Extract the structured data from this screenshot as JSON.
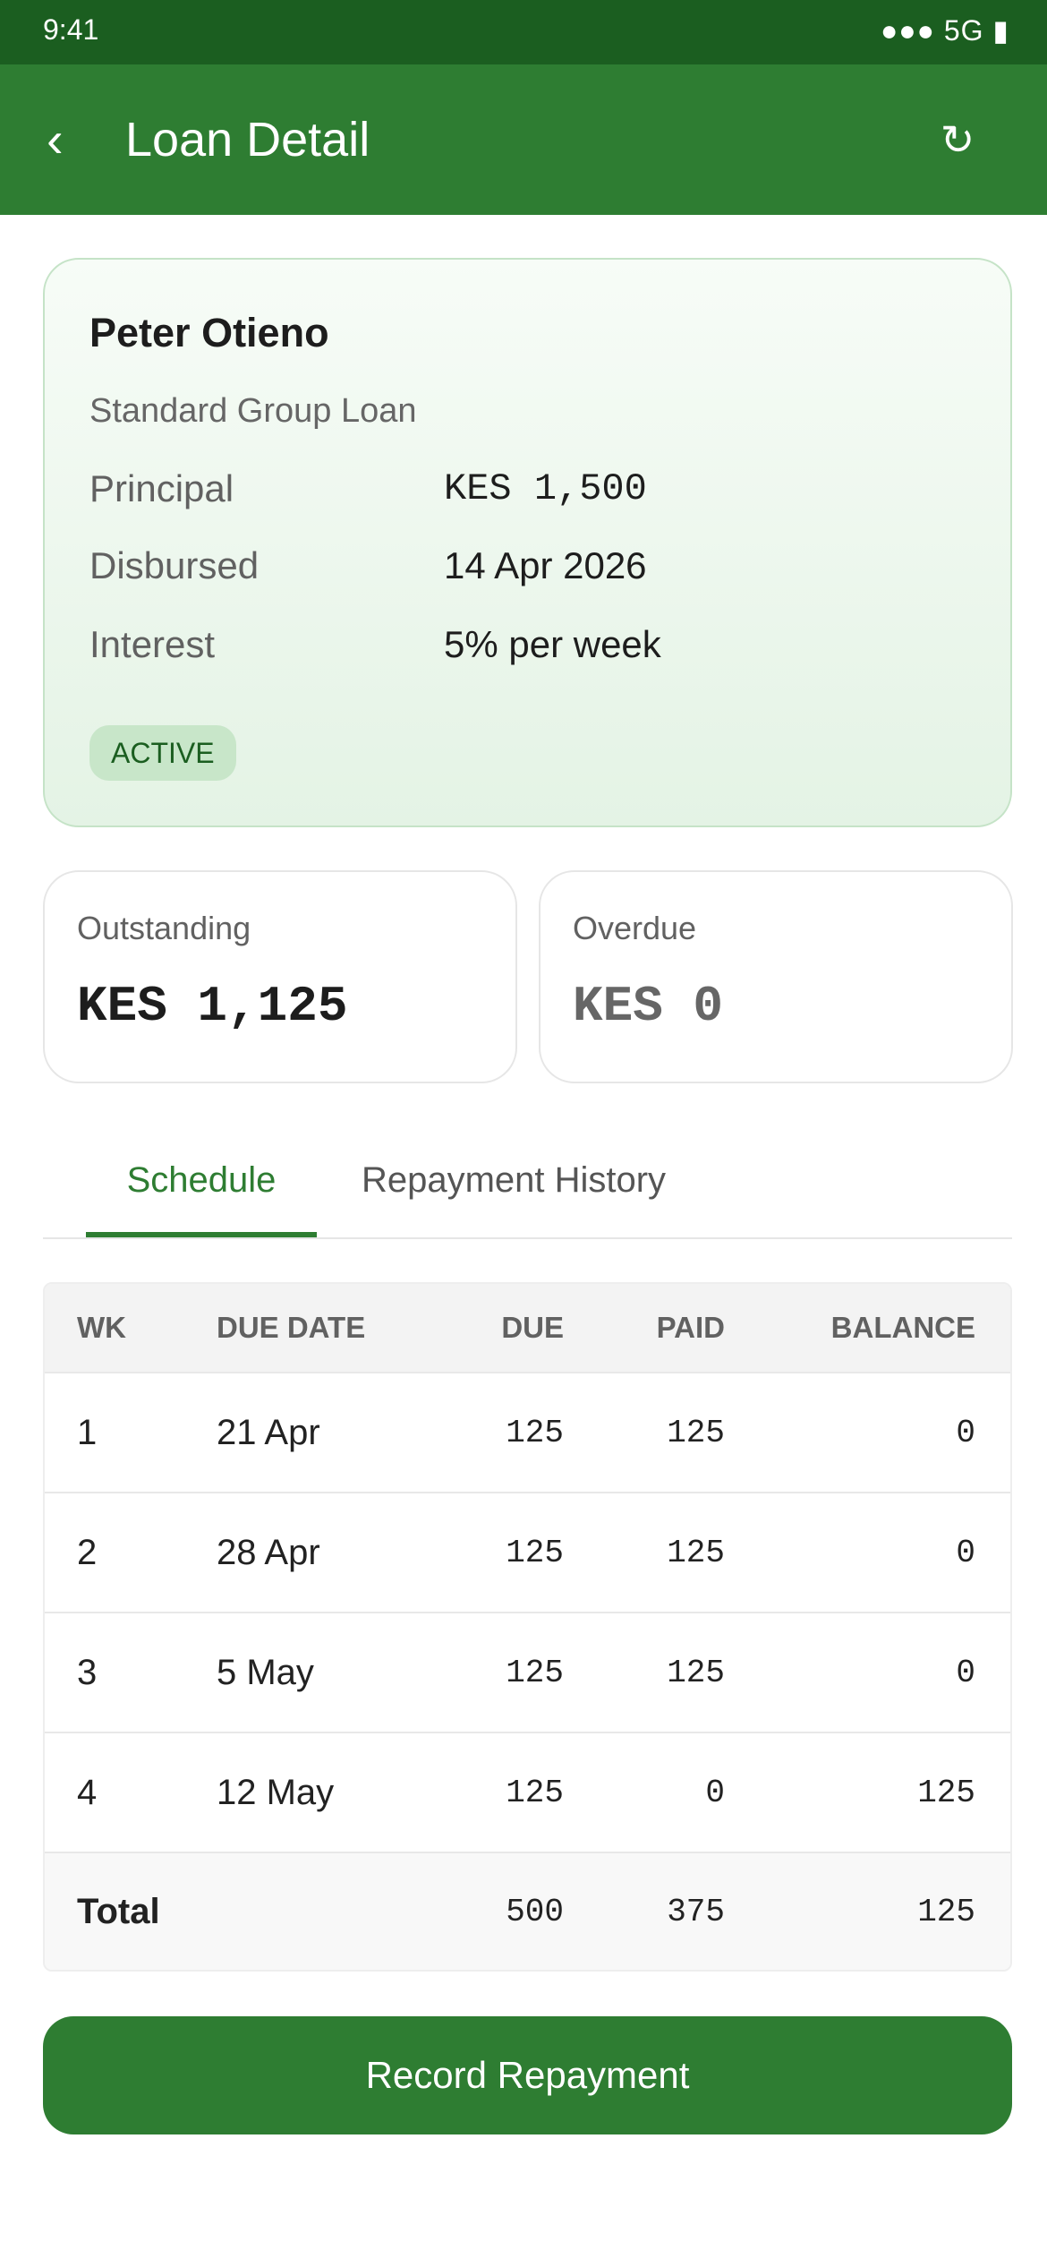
{
  "status_bar": {
    "time": "9:41",
    "indicators": "●●● 5G ▮"
  },
  "header": {
    "title": "Loan Detail",
    "back_icon": "‹",
    "refresh_icon": "↻"
  },
  "loan": {
    "borrower": "Peter Otieno",
    "product": "Standard Group Loan",
    "details": [
      {
        "label": "Principal",
        "value": "KES 1,500"
      },
      {
        "label": "Disbursed",
        "value": "14 Apr 2026"
      },
      {
        "label": "Interest",
        "value": "5% per week"
      }
    ],
    "status": "ACTIVE"
  },
  "summary": {
    "outstanding": {
      "label": "Outstanding",
      "value": "KES 1,125"
    },
    "overdue": {
      "label": "Overdue",
      "value": "KES 0"
    }
  },
  "tabs": [
    {
      "label": "Schedule",
      "active": true
    },
    {
      "label": "Repayment History",
      "active": false
    }
  ],
  "schedule": {
    "columns": [
      "WK",
      "DUE DATE",
      "DUE",
      "PAID",
      "BALANCE"
    ],
    "rows": [
      {
        "wk": "1",
        "date": "21 Apr",
        "due": "125",
        "paid": "125",
        "balance": "0"
      },
      {
        "wk": "2",
        "date": "28 Apr",
        "due": "125",
        "paid": "125",
        "balance": "0"
      },
      {
        "wk": "3",
        "date": "5 May",
        "due": "125",
        "paid": "125",
        "balance": "0"
      },
      {
        "wk": "4",
        "date": "12 May",
        "due": "125",
        "paid": "0",
        "balance": "125"
      }
    ],
    "total": {
      "label": "Total",
      "due": "500",
      "paid": "375",
      "balance": "125"
    }
  },
  "actions": {
    "record_label": "Record Repayment"
  },
  "colors": {
    "primary": "#2e7d32",
    "primary_dark": "#1b5e20",
    "status_bg": "#c8e6c9"
  },
  "icons": {
    "back": "chevron-left-icon",
    "refresh": "refresh-icon"
  }
}
